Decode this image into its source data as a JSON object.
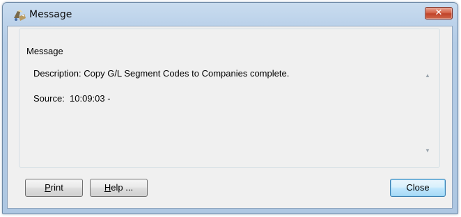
{
  "window": {
    "title": "Message",
    "icon": "app-icon",
    "close_glyph": "✕"
  },
  "group": {
    "label": "Message"
  },
  "message": {
    "description": "Description: Copy G/L Segment Codes to Companies complete.",
    "source": "Source:  10:09:03 -"
  },
  "scrollbar": {
    "up_glyph": "▲",
    "down_glyph": "▼"
  },
  "buttons": {
    "print": {
      "mnemonic": "P",
      "rest": "rint"
    },
    "help": {
      "mnemonic": "H",
      "rest": "elp ..."
    },
    "close": {
      "label": "Close"
    }
  },
  "colors": {
    "close_button_red": "#c0432a",
    "default_button_blue": "#3c7fb1",
    "titlebar_blue": "#bcd2ea"
  }
}
